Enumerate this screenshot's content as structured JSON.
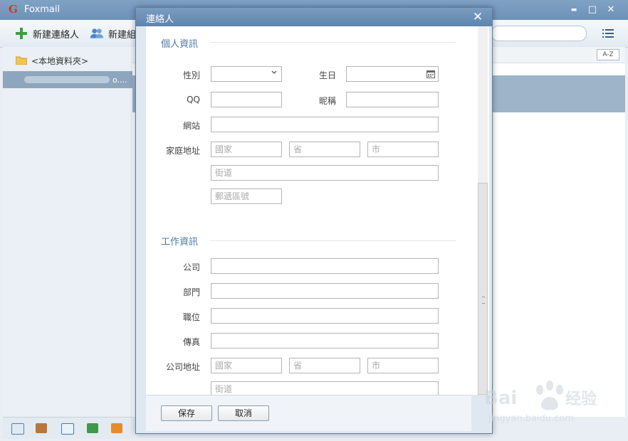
{
  "app": {
    "title": "Foxmail",
    "logo_letter": "G"
  },
  "window_controls": {
    "minimize": "▬",
    "maximize": "□",
    "close": "✕"
  },
  "toolbar": {
    "new_contact_label": "新建連絡人",
    "new_group_label": "新建組"
  },
  "sidebar": {
    "folder_label": "<本地資料夾>",
    "contact_suffix": "o...."
  },
  "list": {
    "sort_label": "A-Z"
  },
  "dialog": {
    "title": "連絡人",
    "close": "✕",
    "personal": {
      "section_title": "個人資訊",
      "gender_label": "性別",
      "birthday_label": "生日",
      "qq_label": "QQ",
      "nickname_label": "昵稱",
      "website_label": "網站",
      "home_address_label": "家庭地址",
      "country_placeholder": "國家",
      "province_placeholder": "省",
      "city_placeholder": "市",
      "street_placeholder": "街道",
      "postal_placeholder": "郵遞區號"
    },
    "work": {
      "section_title": "工作資訊",
      "company_label": "公司",
      "department_label": "部門",
      "position_label": "職位",
      "fax_label": "傳真",
      "company_address_label": "公司地址",
      "country_placeholder": "國家",
      "province_placeholder": "省",
      "city_placeholder": "市",
      "street_placeholder": "街道"
    },
    "save_label": "保存",
    "cancel_label": "取消"
  },
  "colors": {
    "accent": "#4c78a6",
    "titlebar": "#6d92b8",
    "selected_row": "#8ea6bd"
  }
}
